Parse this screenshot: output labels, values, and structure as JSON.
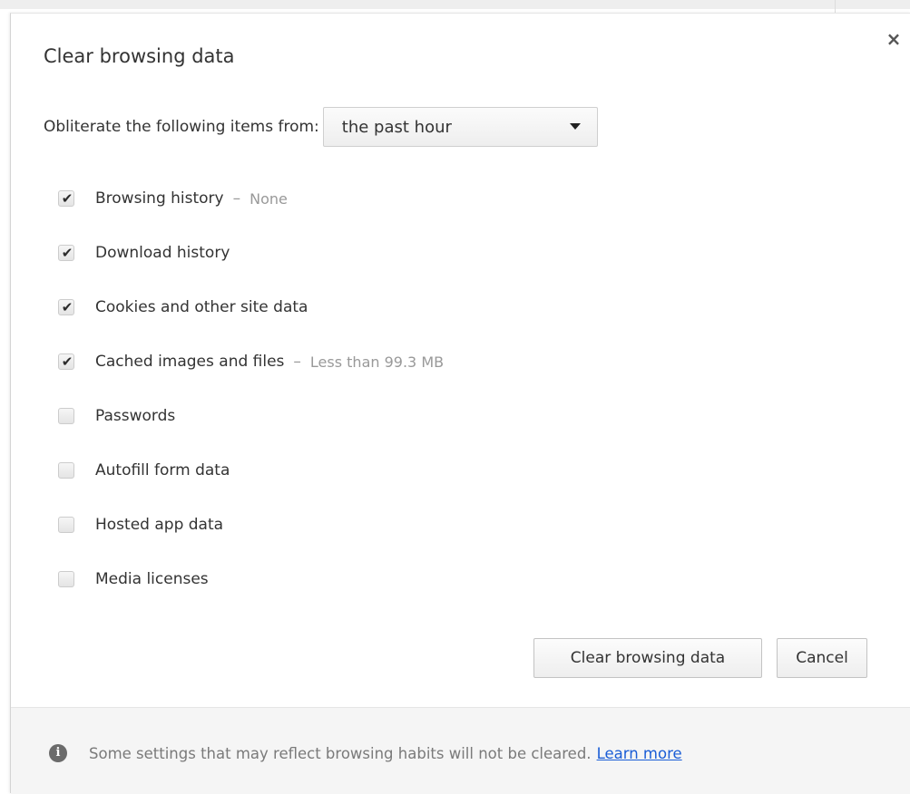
{
  "dialog": {
    "title": "Clear browsing data",
    "close_icon": "close-icon",
    "close_glyph": "×"
  },
  "time_range": {
    "label": "Obliterate the following items from:",
    "selected": "the past hour",
    "arrow_icon": "dropdown-arrow-icon"
  },
  "options": [
    {
      "label": "Browsing history",
      "detail": "None",
      "checked": true
    },
    {
      "label": "Download history",
      "detail": "",
      "checked": true
    },
    {
      "label": "Cookies and other site data",
      "detail": "",
      "checked": true
    },
    {
      "label": "Cached images and files",
      "detail": "Less than 99.3 MB",
      "checked": true
    },
    {
      "label": "Passwords",
      "detail": "",
      "checked": false
    },
    {
      "label": "Autofill form data",
      "detail": "",
      "checked": false
    },
    {
      "label": "Hosted app data",
      "detail": "",
      "checked": false
    },
    {
      "label": "Media licenses",
      "detail": "",
      "checked": false
    }
  ],
  "separator": "–",
  "check_glyph": "✔",
  "buttons": {
    "clear_label": "Clear browsing data",
    "cancel_label": "Cancel"
  },
  "footer": {
    "info_icon": "info-icon",
    "info_glyph": "i",
    "text": "Some settings that may reflect browsing habits will not be cleared.",
    "link": "Learn more"
  },
  "colors": {
    "link": "#1a5dd6",
    "muted_text": "#999999",
    "footer_bg": "#f5f5f5"
  }
}
